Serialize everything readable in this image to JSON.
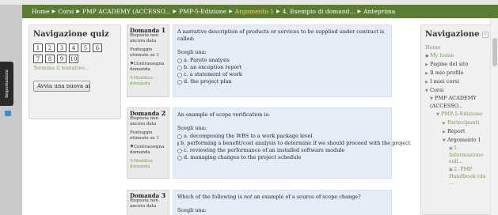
{
  "breadcrumb": [
    "Home",
    "Corsi",
    "PMP ACADEMY (ACCESSO...",
    "PMP-5-Edizione",
    "Argomento 1",
    "4. Esempio di domand...",
    "Anteprima"
  ],
  "side_tab": "Impostazioni",
  "quiz_nav": {
    "title": "Navigazione quiz",
    "numbers": [
      "1",
      "2",
      "3",
      "4",
      "5",
      "6",
      "7",
      "8",
      "9",
      "10"
    ],
    "finish": "Termina il tentativo...",
    "restart": "Avvia una nuova anteprima"
  },
  "questions": [
    {
      "label": "Domanda",
      "number": "1",
      "status": "Risposta non ancora data",
      "score": "Punteggio ottenuto su 1",
      "flag": "Contrassegna domanda",
      "edit": "Modifica domanda",
      "text": "A narrative description of products or services to be supplied under contract is called:",
      "choose": "Scegli una:",
      "options": [
        "a. Pareto analysis",
        "b. an exception report",
        "c. a statement of work",
        "d. the project plan"
      ]
    },
    {
      "label": "Domanda",
      "number": "2",
      "status": "Risposta non ancora data",
      "score": "Punteggio ottenuto su 1",
      "flag": "Contrassegna domanda",
      "edit": "Modifica domanda",
      "text": "An example of scope verification is:",
      "choose": "Scegli una:",
      "options": [
        "a. decomposing the WBS to a work package level",
        "b. performing a benefit/cost analysis to determine if we should proceed with the project",
        "c. reviewing the performance of an installed software module",
        "d. managing changes to the project schedule"
      ]
    },
    {
      "label": "Domanda",
      "number": "3",
      "status": "Risposta non ancora data",
      "text_before": "Which of the following is ",
      "text_em": "not",
      "text_after": " an example of a source of scope change?",
      "choose": "Scegli una:"
    }
  ],
  "nav": {
    "title": "Navigazione",
    "home": "Home",
    "myhome": "My home",
    "pagine": "Pagine del sito",
    "profilo": "Il mio profilo",
    "miei_corsi": "I miei corsi",
    "corsi": "Corsi",
    "academy": "PMP ACADEMY (ACCESSO...",
    "edizione": "PMP-5-Edizione",
    "partecipanti": "Partecipanti",
    "report": "Report",
    "argomento": "Argomento 1",
    "item1": "1. Informazione sull...",
    "item2": "2. PMP Handbook (da ..."
  }
}
